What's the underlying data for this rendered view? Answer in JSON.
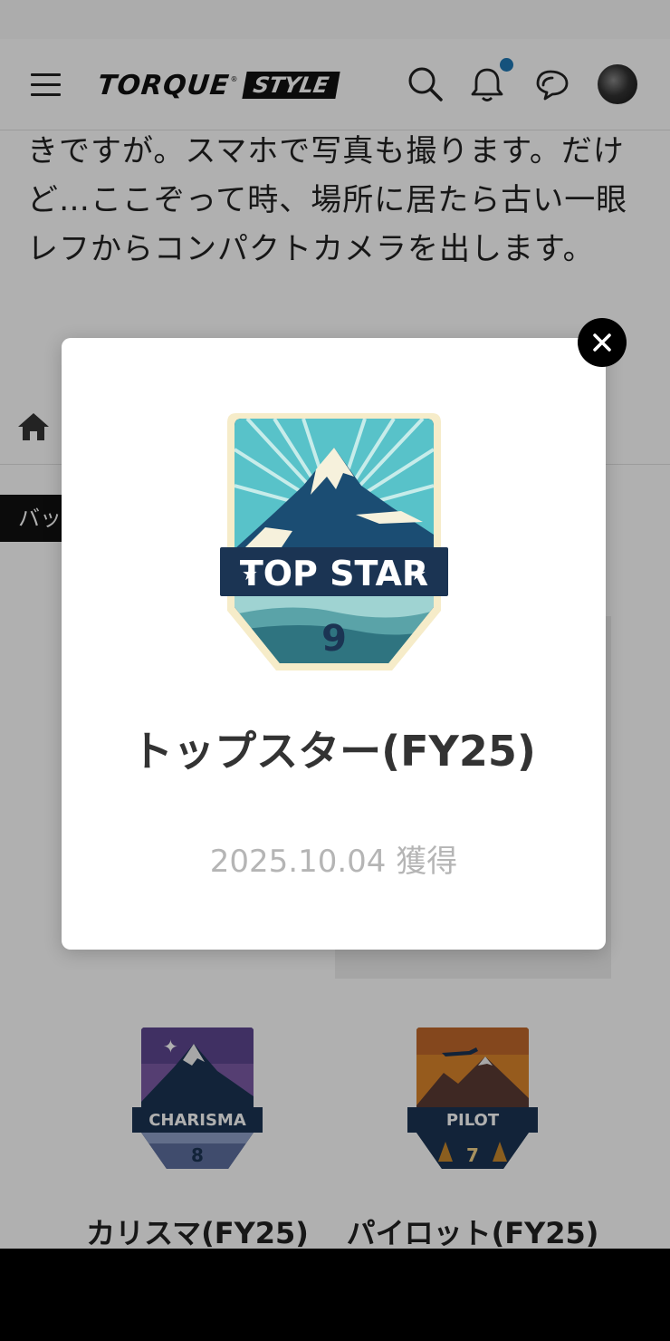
{
  "header": {
    "logo_main": "TORQUE",
    "logo_reg": "®",
    "logo_style": "STYLE",
    "icons": [
      "menu-icon",
      "search-icon",
      "bell-icon",
      "chat-icon",
      "avatar"
    ]
  },
  "article": {
    "text": "きですが。スマホで写真も撮ります。だけど…ここぞって時、場所に居たら古い一眼レフからコンパクトカメラを出します。"
  },
  "side_tab": {
    "label": "バッジ"
  },
  "badges": [
    {
      "name": "カリスマ(FY25)",
      "badge_text": "CHARISMA",
      "level": "8",
      "color": "#7b5aa6"
    },
    {
      "name": "パイロット(FY25)",
      "badge_text": "PILOT",
      "level": "7",
      "color": "#d9842b"
    }
  ],
  "modal": {
    "badge_text": "TOP STAR",
    "badge_level": "9",
    "title": "トップスター(FY25)",
    "date": "2025.10.04 獲得"
  },
  "colors": {
    "accent": "#1f78b4",
    "badge_navy": "#1b3453",
    "badge_teal": "#4fb3bf"
  }
}
